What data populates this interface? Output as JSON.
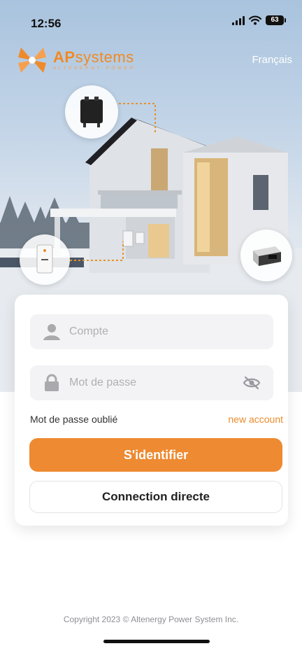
{
  "status_bar": {
    "time": "12:56",
    "battery": "63"
  },
  "brand": {
    "name_ap": "AP",
    "name_rest": "systems",
    "tagline": "ALTENERGY POWER",
    "accent": "#EE8A31"
  },
  "header": {
    "language": "Français"
  },
  "login": {
    "account_placeholder": "Compte",
    "password_placeholder": "Mot de passe",
    "forgot_password": "Mot de passe oublié",
    "new_account": "new account",
    "sign_in": "S'identifier",
    "direct_connection": "Connection directe"
  },
  "footer": {
    "copyright": "Copyright 2023 © Altenergy Power System Inc."
  },
  "icons": [
    "user-icon",
    "lock-icon",
    "eye-off-icon",
    "signal-icon",
    "wifi-icon",
    "battery-icon"
  ]
}
